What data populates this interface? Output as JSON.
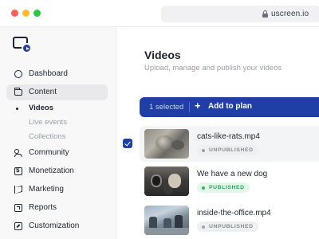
{
  "browser": {
    "url": "uscreen.io"
  },
  "sidebar": {
    "items": [
      {
        "label": "Dashboard",
        "icon": "dashboard-icon"
      },
      {
        "label": "Content",
        "icon": "folder-icon",
        "active": true
      },
      {
        "label": "Community",
        "icon": "people-icon"
      },
      {
        "label": "Monetization",
        "icon": "money-icon"
      },
      {
        "label": "Marketing",
        "icon": "megaphone-icon"
      },
      {
        "label": "Reports",
        "icon": "report-icon"
      },
      {
        "label": "Customization",
        "icon": "customization-icon"
      }
    ],
    "content_subitems": [
      {
        "label": "Videos",
        "active": true
      },
      {
        "label": "Live events"
      },
      {
        "label": "Collections"
      }
    ]
  },
  "main": {
    "title": "Videos",
    "subtitle": "Upload, manage and publish your videos",
    "action_bar": {
      "selected_count": "1 selected",
      "add_icon": "+",
      "add_label": "Add to plan"
    },
    "videos": [
      {
        "name": "cats-like-rats.mp4",
        "status": "UNPUBLISHED",
        "selected": true
      },
      {
        "name": "We have a new dog",
        "status": "PUBLISHED",
        "selected": false
      },
      {
        "name": "inside-the-office.mp4",
        "status": "UNPUBLISHED",
        "selected": false
      }
    ]
  },
  "colors": {
    "accent": "#1f3fa6",
    "published": "#2fa25a",
    "unpublished": "#868a93"
  }
}
